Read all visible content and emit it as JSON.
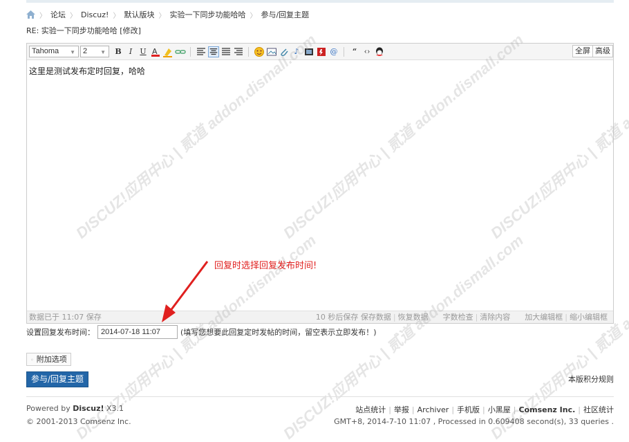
{
  "breadcrumb": {
    "items": [
      "论坛",
      "Discuz!",
      "默认版块",
      "实验一下同步功能哈哈",
      "参与/回复主题"
    ]
  },
  "reply_title": "RE: 实验一下同步功能哈哈 [修改]",
  "toolbar": {
    "font_family": "Tahoma",
    "font_size": "2",
    "fullscreen_label": "全屏",
    "advanced_label": "高级"
  },
  "editor": {
    "content": "这里是测试发布定时回复，哈哈"
  },
  "statusbar": {
    "saved_text": "数据已于 11:07 保存",
    "autosave_text": "10 秒后保存",
    "save_data": "保存数据",
    "restore_data": "恢复数据",
    "word_check": "字数检查",
    "clear_content": "清除内容",
    "enlarge_editor": "加大编辑框",
    "shrink_editor": "缩小编辑框"
  },
  "annotation_text": "回复时选择回复发布时间!",
  "time_field": {
    "label": "设置回复发布时间：",
    "value": "2014-07-18 11:07",
    "hint": "(填写您想要此回复定时发帖的时间，留空表示立即发布！)"
  },
  "attach_label": "附加选项",
  "submit_label": "参与/回复主题",
  "rules_label": "本版积分规则",
  "footer": {
    "powered_prefix": "Powered by",
    "powered_brand": "Discuz!",
    "powered_version": "X3.1",
    "copyright": "© 2001-2013 Comsenz Inc.",
    "links": [
      "站点统计",
      "举报",
      "Archiver",
      "手机版",
      "小黑屋"
    ],
    "company": "Comsenz Inc.",
    "last_link": "社区统计",
    "stats": "GMT+8, 2014-7-10 11:07 , Processed in 0.609408 second(s), 33 queries ."
  },
  "watermark_text": "DISCUZ!应用中心 | 贰道 addon.dismall.com",
  "colors": {
    "accent": "#2366a8",
    "annotation": "#e0201f"
  }
}
